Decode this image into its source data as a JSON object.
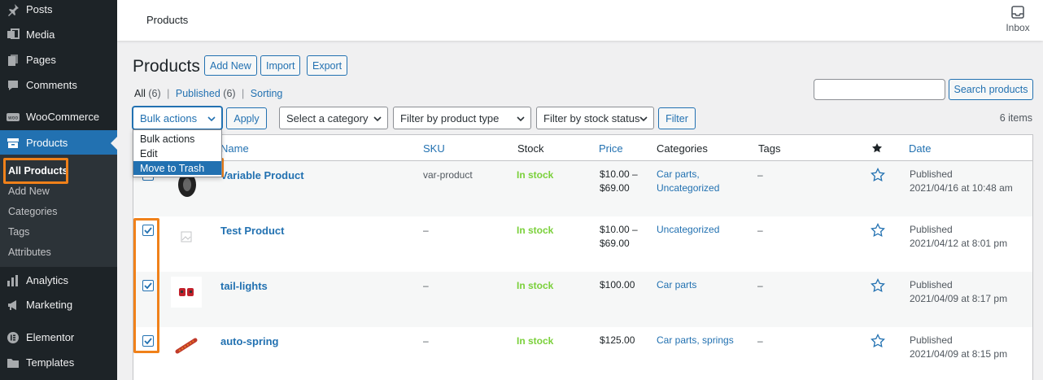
{
  "sidebar": {
    "items": [
      {
        "label": "Posts",
        "icon": "pin-icon"
      },
      {
        "label": "Media",
        "icon": "media-icon"
      },
      {
        "label": "Pages",
        "icon": "pages-icon"
      },
      {
        "label": "Comments",
        "icon": "comment-icon"
      },
      {
        "label": "WooCommerce",
        "icon": "woocommerce-icon"
      },
      {
        "label": "Products",
        "icon": "archive-icon"
      },
      {
        "label": "Analytics",
        "icon": "chart-bar-icon"
      },
      {
        "label": "Marketing",
        "icon": "megaphone-icon"
      },
      {
        "label": "Elementor",
        "icon": "elementor-icon"
      },
      {
        "label": "Templates",
        "icon": "folder-icon"
      }
    ],
    "submenu": [
      "All Products",
      "Add New",
      "Categories",
      "Tags",
      "Attributes"
    ]
  },
  "topbar": {
    "title": "Products",
    "inbox_label": "Inbox"
  },
  "heading": {
    "title": "Products",
    "add_new": "Add New",
    "import": "Import",
    "export": "Export"
  },
  "views": {
    "all": "All",
    "all_count": "(6)",
    "published": "Published",
    "published_count": "(6)",
    "sorting": "Sorting",
    "sep": "|"
  },
  "search": {
    "button": "Search products",
    "placeholder": ""
  },
  "filters": {
    "bulk_actions": "Bulk actions",
    "apply": "Apply",
    "category": "Select a category",
    "product_type": "Filter by product type",
    "stock_status": "Filter by stock status",
    "filter": "Filter",
    "items_count": "6 items"
  },
  "bulk_dropdown": {
    "options": [
      "Bulk actions",
      "Edit",
      "Move to Trash"
    ],
    "selected": "Move to Trash"
  },
  "table": {
    "columns": {
      "name": "Name",
      "sku": "SKU",
      "stock": "Stock",
      "price": "Price",
      "categories": "Categories",
      "tags": "Tags",
      "date": "Date"
    },
    "rows": [
      {
        "name": "Variable Product",
        "sku": "var-product",
        "stock": "In stock",
        "price_line1": "$10.00 –",
        "price_line2": "$69.00",
        "categories": "Car parts,",
        "categories2": "Uncategorized",
        "tags": "–",
        "date_status": "Published",
        "date": "2021/04/16 at 10:48 am",
        "checked": false
      },
      {
        "name": "Test Product",
        "sku": "–",
        "stock": "In stock",
        "price_line1": "$10.00 –",
        "price_line2": "$69.00",
        "categories": "Uncategorized",
        "categories2": "",
        "tags": "–",
        "date_status": "Published",
        "date": "2021/04/12 at 8:01 pm",
        "checked": true
      },
      {
        "name": "tail-lights",
        "sku": "–",
        "stock": "In stock",
        "price_line1": "$100.00",
        "price_line2": "",
        "categories": "Car parts",
        "categories2": "",
        "tags": "–",
        "date_status": "Published",
        "date": "2021/04/09 at 8:17 pm",
        "checked": true
      },
      {
        "name": "auto-spring",
        "sku": "–",
        "stock": "In stock",
        "price_line1": "$125.00",
        "price_line2": "",
        "categories": "Car parts, springs",
        "categories2": "",
        "tags": "–",
        "date_status": "Published",
        "date": "2021/04/09 at 8:15 pm",
        "checked": true
      }
    ]
  },
  "colors": {
    "accent": "#2271b1",
    "highlight": "#f0811a",
    "sidebar": "#1d2327",
    "in_stock": "#7ad03a"
  }
}
